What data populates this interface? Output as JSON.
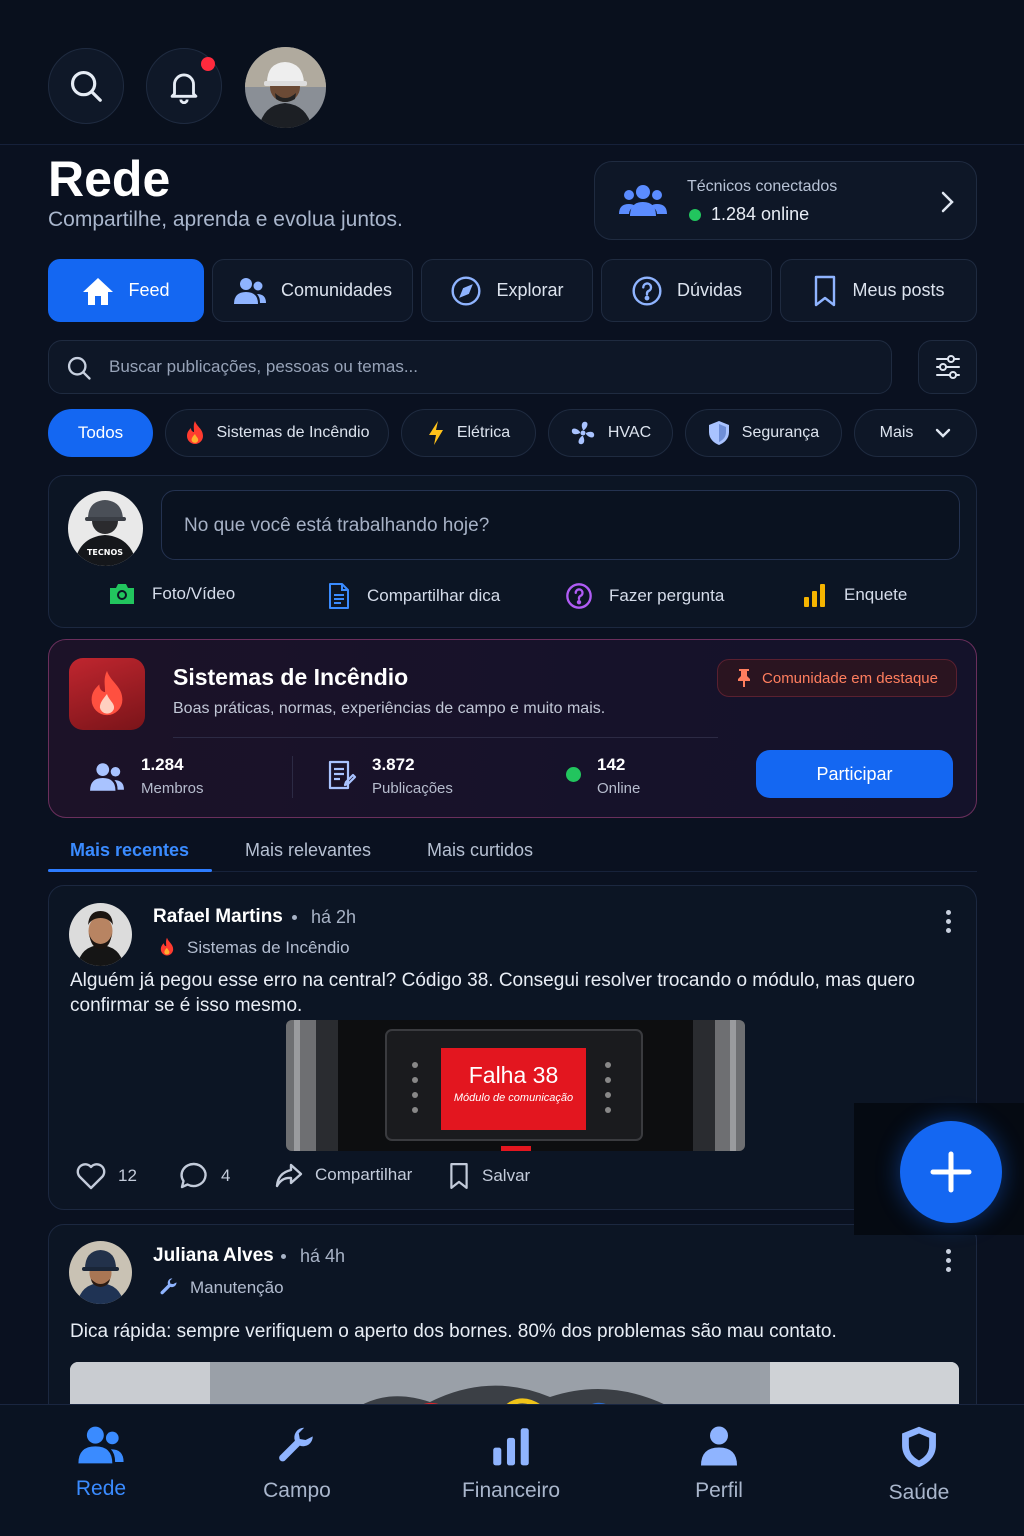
{
  "header": {
    "title": "Rede",
    "subtitle": "Compartilhe, aprenda e evolua juntos."
  },
  "online": {
    "label": "Técnicos conectados",
    "value": "1.284 online"
  },
  "tabs": [
    {
      "label": "Feed",
      "icon": "home-icon",
      "active": true
    },
    {
      "label": "Comunidades",
      "icon": "users-icon"
    },
    {
      "label": "Explorar",
      "icon": "compass-icon"
    },
    {
      "label": "Dúvidas",
      "icon": "question-icon"
    },
    {
      "label": "Meus posts",
      "icon": "bookmark-icon"
    }
  ],
  "search": {
    "placeholder": "Buscar publicações, pessoas ou temas..."
  },
  "chips": [
    {
      "label": "Todos",
      "active": true
    },
    {
      "label": "Sistemas de Incêndio",
      "icon": "flame-icon"
    },
    {
      "label": "Elétrica",
      "icon": "bolt-icon"
    },
    {
      "label": "HVAC",
      "icon": "fan-icon"
    },
    {
      "label": "Segurança",
      "icon": "shield-icon"
    },
    {
      "label": "Mais",
      "icon": "chevron-down-icon"
    }
  ],
  "composer": {
    "avatar_text": "TECNOS",
    "placeholder": "No que você está trabalhando hoje?",
    "actions": [
      {
        "label": "Foto/Vídeo",
        "icon": "camera-icon"
      },
      {
        "label": "Compartilhar dica",
        "icon": "document-icon"
      },
      {
        "label": "Fazer pergunta",
        "icon": "question-icon"
      },
      {
        "label": "Enquete",
        "icon": "bar-chart-icon"
      }
    ]
  },
  "community": {
    "title": "Sistemas de Incêndio",
    "description": "Boas práticas, normas, experiências de campo e muito mais.",
    "badge": "Comunidade em destaque",
    "stats": [
      {
        "value": "1.284",
        "label": "Membros"
      },
      {
        "value": "3.872",
        "label": "Publicações"
      },
      {
        "value": "142",
        "label": "Online"
      }
    ],
    "join_label": "Participar"
  },
  "sort_tabs": [
    {
      "label": "Mais recentes",
      "active": true
    },
    {
      "label": "Mais relevantes"
    },
    {
      "label": "Mais curtidos"
    }
  ],
  "posts": [
    {
      "author": "Rafael Martins",
      "time": "há 2h",
      "category": "Sistemas de Incêndio",
      "text": "Alguém já pegou esse erro na central? Código 38. Consegui resolver trocando o módulo, mas quero confirmar se é isso mesmo.",
      "image_title": "Falha 38",
      "image_subtitle": "Módulo de comunicação",
      "likes": "12",
      "comments": "4",
      "share_label": "Compartilhar",
      "save_label": "Salvar"
    },
    {
      "author": "Juliana Alves",
      "time": "há 4h",
      "category": "Manutenção",
      "text": "Dica rápida: sempre verifiquem o aperto dos bornes. 80% dos problemas são mau contato."
    }
  ],
  "bottom_nav": [
    {
      "label": "Rede",
      "icon": "users-icon",
      "active": true
    },
    {
      "label": "Campo",
      "icon": "wrench-icon"
    },
    {
      "label": "Financeiro",
      "icon": "bar-chart-icon"
    },
    {
      "label": "Perfil",
      "icon": "user-icon"
    },
    {
      "label": "Saúde",
      "icon": "shield-icon"
    }
  ],
  "colors": {
    "background": "#0a1120",
    "accent": "#1467f2",
    "online": "#22c55e",
    "fire": "#e0282f",
    "badge_text": "#ff7e5e"
  }
}
